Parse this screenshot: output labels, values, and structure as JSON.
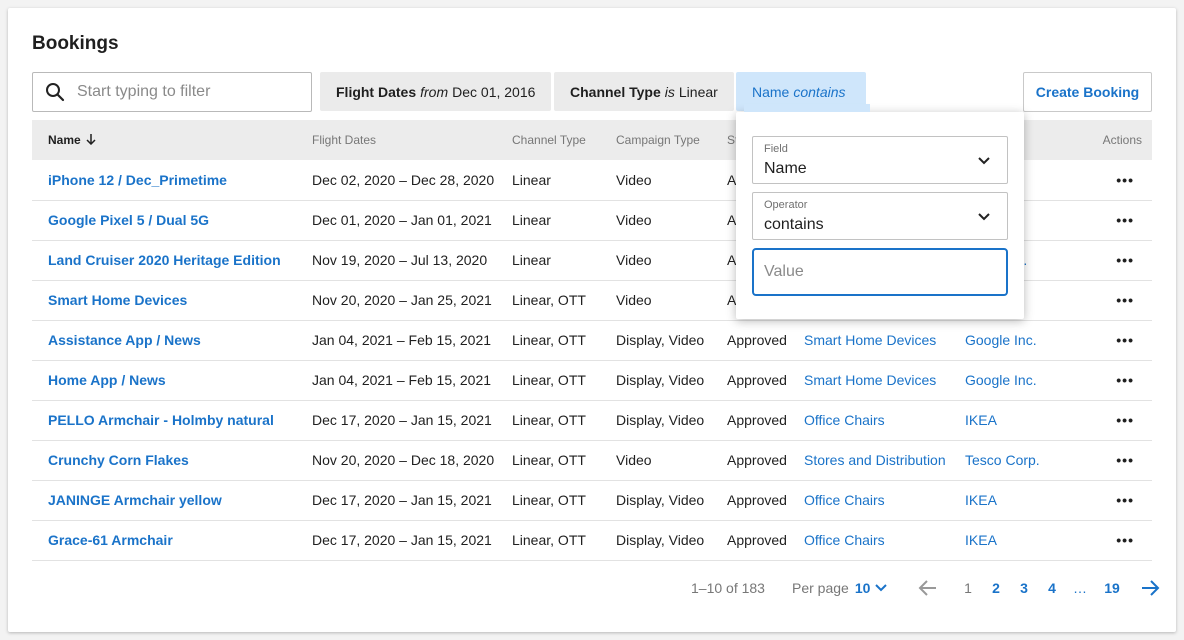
{
  "page": {
    "title": "Bookings"
  },
  "search": {
    "placeholder": "Start typing to filter"
  },
  "filters": [
    {
      "field": "Flight Dates",
      "operator": "from",
      "value": "Dec 01, 2016"
    },
    {
      "field": "Channel Type",
      "operator": "is",
      "value": "Linear"
    },
    {
      "field": "Name",
      "operator": "contains",
      "value": ""
    }
  ],
  "create_button": "Create Booking",
  "table": {
    "headers": [
      "Name",
      "Flight Dates",
      "Channel Type",
      "Campaign Type",
      "St",
      "",
      "",
      "Actions"
    ],
    "rows": [
      [
        "iPhone 12 / Dec_Primetime",
        "Dec 02, 2020 – Dec 28, 2020",
        "Linear",
        "Video",
        "A",
        "",
        "",
        "•••"
      ],
      [
        "Google Pixel 5 / Dual 5G",
        "Dec 01, 2020 – Jan 01, 2021",
        "Linear",
        "Video",
        "A",
        "",
        "Inc.",
        "•••"
      ],
      [
        "Land Cruiser 2020 Heritage Edition",
        "Nov 19, 2020 – Jul 13, 2020",
        "Linear",
        "Video",
        "A",
        "",
        "otor Corp.",
        "•••"
      ],
      [
        "Smart Home Devices",
        "Nov 20, 2020 – Jan 25, 2021",
        "Linear, OTT",
        "Video",
        "A",
        "",
        "Inc.",
        "•••"
      ],
      [
        "Assistance App / News",
        "Jan 04, 2021 – Feb 15, 2021",
        "Linear, OTT",
        "Display, Video",
        "Approved",
        "Smart Home Devices",
        "Google Inc.",
        "•••"
      ],
      [
        "Home App / News",
        "Jan 04, 2021 – Feb 15, 2021",
        "Linear, OTT",
        "Display, Video",
        "Approved",
        "Smart Home Devices",
        "Google Inc.",
        "•••"
      ],
      [
        "PELLO Armchair - Holmby natural",
        "Dec 17, 2020 – Jan 15, 2021",
        "Linear, OTT",
        "Display, Video",
        "Approved",
        "Office Chairs",
        "IKEA",
        "•••"
      ],
      [
        "Crunchy Corn Flakes",
        "Nov 20, 2020 – Dec 18, 2020",
        "Linear, OTT",
        "Video",
        "Approved",
        "Stores and Distribution",
        "Tesco Corp.",
        "•••"
      ],
      [
        "JANINGE Armchair yellow",
        "Dec 17, 2020 – Jan 15, 2021",
        "Linear, OTT",
        "Display, Video",
        "Approved",
        "Office Chairs",
        "IKEA",
        "•••"
      ],
      [
        "Grace-61 Armchair",
        "Dec 17, 2020 – Jan 15, 2021",
        "Linear, OTT",
        "Display, Video",
        "Approved",
        "Office Chairs",
        "IKEA",
        "•••"
      ]
    ]
  },
  "popover": {
    "field_label": "Field",
    "field_value": "Name",
    "operator_label": "Operator",
    "operator_value": "contains",
    "value_placeholder": "Value"
  },
  "pagination": {
    "range": "1–10 of 183",
    "per_page_label": "Per page",
    "per_page_value": "10",
    "pages": [
      "1",
      "2",
      "3",
      "4",
      "…",
      "19"
    ],
    "current": "1"
  },
  "colors": {
    "accent": "#1a73c9",
    "active_chip": "#cfe6fb",
    "chip": "#ebebeb",
    "header_row": "#ececec"
  },
  "icons": [
    "search-icon",
    "sort-arrow-down-icon",
    "chevron-down-icon",
    "more-icon",
    "arrow-left-icon",
    "arrow-right-icon"
  ]
}
